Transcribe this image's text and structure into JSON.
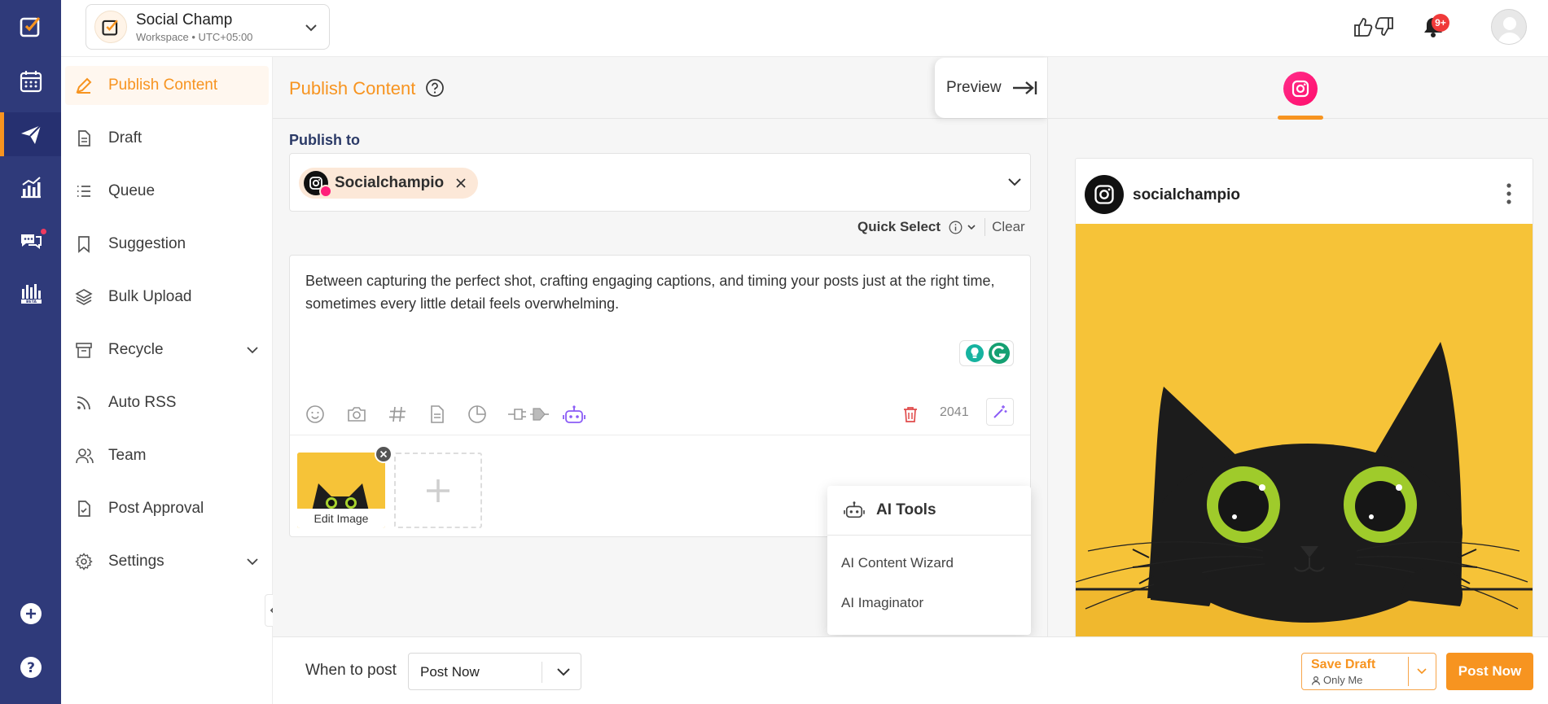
{
  "workspace": {
    "name": "Social Champ",
    "subtitle": "Workspace • UTC+05:00"
  },
  "header": {
    "notification_badge": "9+"
  },
  "rail": {
    "icons": [
      "app-logo-icon",
      "calendar-icon",
      "send-icon",
      "analytics-icon",
      "chat-icon",
      "beta-analytics-icon",
      "add-icon",
      "help-icon"
    ],
    "active": "send-icon"
  },
  "sidebar": {
    "items": [
      {
        "label": "Publish Content",
        "icon": "pencil-icon",
        "active": true
      },
      {
        "label": "Draft",
        "icon": "document-icon"
      },
      {
        "label": "Queue",
        "icon": "list-icon"
      },
      {
        "label": "Suggestion",
        "icon": "bookmark-icon"
      },
      {
        "label": "Bulk Upload",
        "icon": "layers-icon"
      },
      {
        "label": "Recycle",
        "icon": "archive-icon",
        "expandable": true
      },
      {
        "label": "Auto RSS",
        "icon": "rss-icon"
      },
      {
        "label": "Team",
        "icon": "team-icon"
      },
      {
        "label": "Post Approval",
        "icon": "approval-icon"
      },
      {
        "label": "Settings",
        "icon": "gear-icon",
        "expandable": true
      }
    ]
  },
  "main": {
    "title": "Publish Content",
    "preview_label": "Preview",
    "publish_to_label": "Publish to",
    "selected_account": "Socialchampio",
    "quick_select_label": "Quick Select",
    "clear_label": "Clear",
    "post_text": "Between capturing the perfect shot, crafting engaging captions, and timing your posts just at the right time, sometimes every little detail feels overwhelming.",
    "char_count": "2041",
    "thumb_label": "Edit Image"
  },
  "ai_menu": {
    "title": "AI Tools",
    "items": [
      "AI Content Wizard",
      "AI Imaginator"
    ]
  },
  "bottom": {
    "when_label": "When to post",
    "when_value": "Post Now",
    "save_draft": "Save Draft",
    "save_draft_sub": "Only Me",
    "post_now": "Post Now"
  },
  "preview": {
    "username": "socialchampio"
  },
  "colors": {
    "accent": "#f79420",
    "rail": "#2f3a7a",
    "instagram": "#ff1f7a",
    "image_bg": "#f6c338"
  }
}
